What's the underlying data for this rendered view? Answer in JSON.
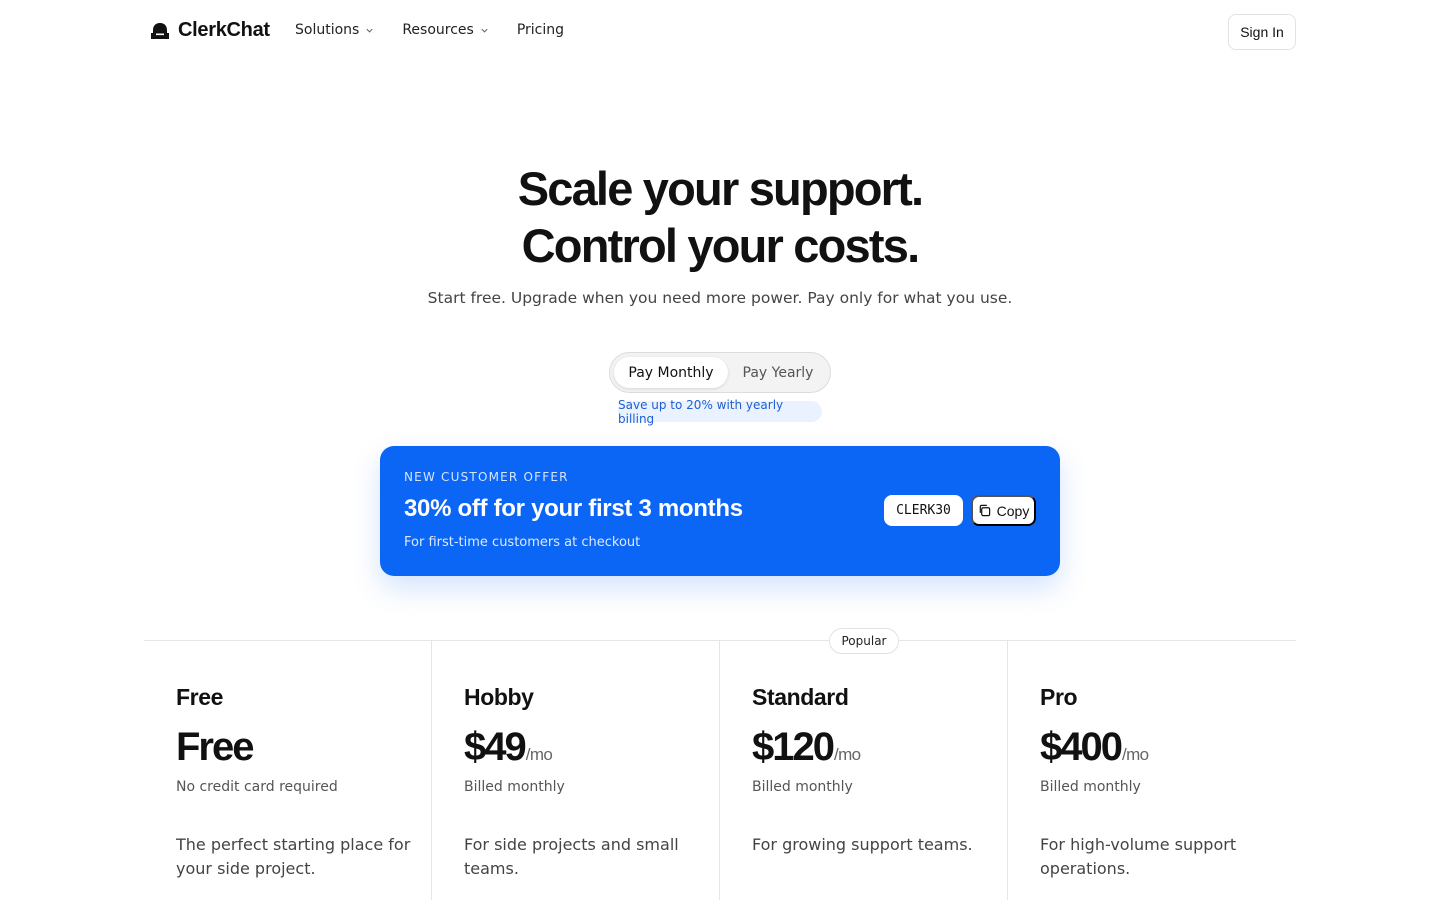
{
  "brand": {
    "name": "ClerkChat"
  },
  "nav": {
    "links": [
      {
        "label": "Solutions",
        "has_dropdown": true
      },
      {
        "label": "Resources",
        "has_dropdown": true
      },
      {
        "label": "Pricing",
        "has_dropdown": false
      }
    ],
    "signin_label": "Sign In"
  },
  "hero": {
    "title_line1": "Scale your support.",
    "title_line2": "Control your costs.",
    "subtitle": "Start free. Upgrade when you need more power. Pay only for what you use."
  },
  "billing_toggle": {
    "options": [
      "Pay Monthly",
      "Pay Yearly"
    ],
    "selected": "Pay Monthly",
    "save_note": "Save up to 20% with yearly billing"
  },
  "offer": {
    "eyebrow": "NEW CUSTOMER OFFER",
    "title": "30% off for your first 3 months",
    "note": "For first-time customers at checkout",
    "code": "CLERK30",
    "copy_label": "Copy",
    "bg_color": "#0b66f5"
  },
  "popular_badge": "Popular",
  "plans": [
    {
      "name": "Free",
      "price": "Free",
      "per": "",
      "billing": "No credit card required",
      "description": "The perfect starting place for your side project."
    },
    {
      "name": "Hobby",
      "price": "$49",
      "per": "/mo",
      "billing": "Billed monthly",
      "description": "For side projects and small teams."
    },
    {
      "name": "Standard",
      "price": "$120",
      "per": "/mo",
      "billing": "Billed monthly",
      "description": "For growing support teams."
    },
    {
      "name": "Pro",
      "price": "$400",
      "per": "/mo",
      "billing": "Billed monthly",
      "description": "For high-volume support operations."
    }
  ]
}
